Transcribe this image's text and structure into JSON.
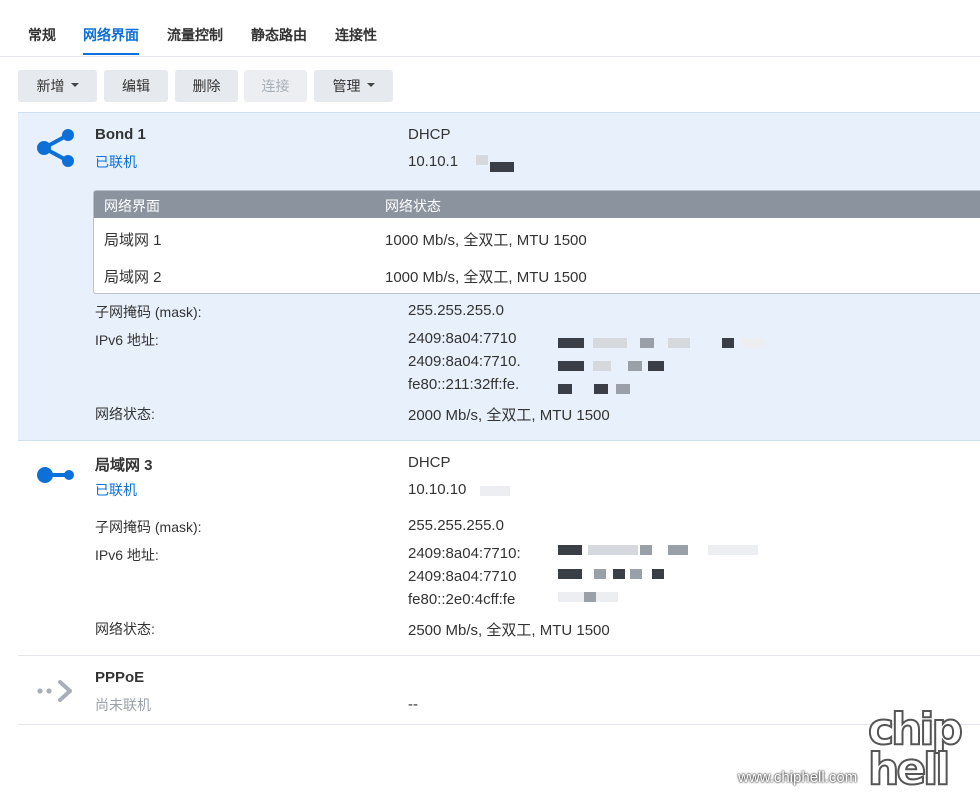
{
  "tabs": [
    "常规",
    "网络界面",
    "流量控制",
    "静态路由",
    "连接性"
  ],
  "toolbar": {
    "add": "新增",
    "edit": "编辑",
    "delete": "删除",
    "connect": "连接",
    "manage": "管理"
  },
  "bond": {
    "name": "Bond 1",
    "status": "已联机",
    "mode": "DHCP",
    "ip": "10.10.1",
    "table": {
      "col1": "网络界面",
      "col2": "网络状态",
      "rows": [
        {
          "iface": "局域网 1",
          "state": "1000 Mb/s, 全双工, MTU 1500"
        },
        {
          "iface": "局域网 2",
          "state": "1000 Mb/s, 全双工, MTU 1500"
        }
      ]
    },
    "mask_label": "子网掩码 (mask):",
    "mask": "255.255.255.0",
    "ipv6_label": "IPv6 地址:",
    "ipv6": [
      "2409:8a04:7710",
      "2409:8a04:7710.",
      "fe80::211:32ff:fe."
    ],
    "state_label": "网络状态:",
    "state": "2000 Mb/s, 全双工, MTU 1500"
  },
  "lan3": {
    "name": "局域网 3",
    "status": "已联机",
    "mode": "DHCP",
    "ip": "10.10.10",
    "mask_label": "子网掩码 (mask):",
    "mask": "255.255.255.0",
    "ipv6_label": "IPv6 地址:",
    "ipv6": [
      "2409:8a04:7710:",
      "2409:8a04:7710",
      "fe80::2e0:4cff:fe"
    ],
    "state_label": "网络状态:",
    "state": "2500 Mb/s, 全双工, MTU 1500"
  },
  "pppoe": {
    "name": "PPPoE",
    "status": "尚未联机",
    "value": "--"
  },
  "watermark": {
    "logo": "chip hell",
    "url": "www.chiphell.com"
  },
  "colors": {
    "accent": "#0d6fd8",
    "selected_bg": "#e8f1fb",
    "header_gray": "#8a939e",
    "disabled_icon": "#a9afb8"
  }
}
